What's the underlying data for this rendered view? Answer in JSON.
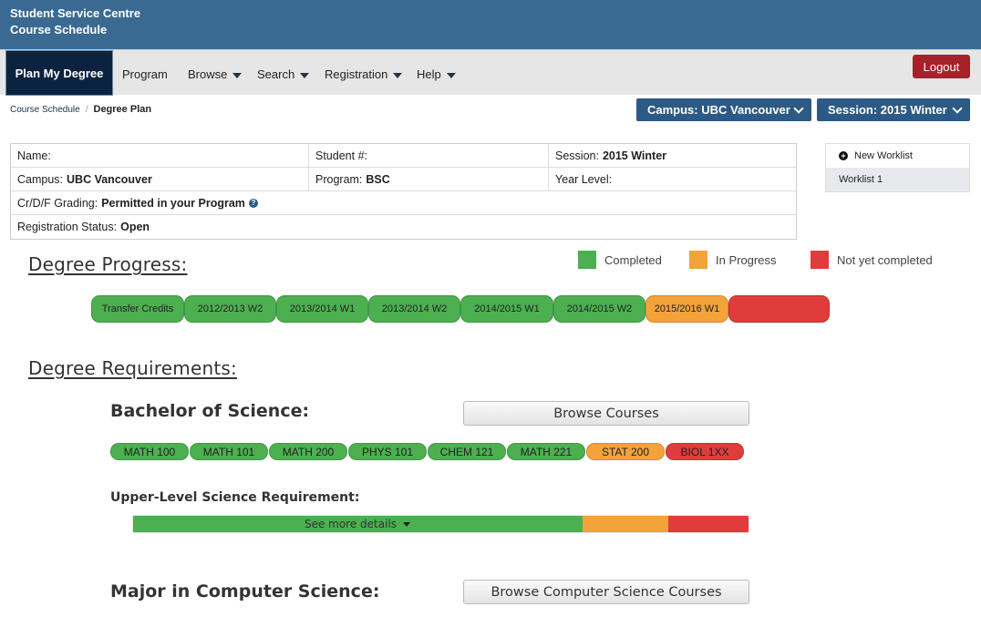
{
  "header": {
    "line1": "Student Service Centre",
    "line2": "Course Schedule"
  },
  "nav": {
    "active": "Plan My Degree",
    "items": [
      {
        "label": "Program",
        "dropdown": false
      },
      {
        "label": "Browse",
        "dropdown": true
      },
      {
        "label": "Search",
        "dropdown": true
      },
      {
        "label": "Registration",
        "dropdown": true
      },
      {
        "label": "Help",
        "dropdown": true
      }
    ],
    "logout": "Logout"
  },
  "breadcrumb": {
    "parent": "Course Schedule",
    "separator": "/",
    "current": "Degree Plan"
  },
  "selectors": {
    "campus": "Campus: UBC Vancouver",
    "session": "Session: 2015 Winter"
  },
  "student_info": {
    "name_label": "Name:",
    "student_no_label": "Student #:",
    "session_label": "Session:",
    "session_value": "2015 Winter",
    "campus_label": "Campus:",
    "campus_value": "UBC Vancouver",
    "program_label": "Program:",
    "program_value": "BSC",
    "year_label": "Year Level:",
    "grading_label": "Cr/D/F Grading:",
    "grading_value": "Permitted in your Program",
    "reg_label": "Registration Status:",
    "reg_value": "Open"
  },
  "worklist": {
    "new_label": "New Worklist",
    "items": [
      "Worklist 1"
    ]
  },
  "progress": {
    "title": "Degree Progress:",
    "legend": [
      {
        "label": "Completed",
        "color": "#4caf50"
      },
      {
        "label": "In Progress",
        "color": "#f4a23a"
      },
      {
        "label": "Not yet completed",
        "color": "#e03c3c"
      }
    ],
    "terms": [
      {
        "label": "Transfer Credits",
        "status": "completed"
      },
      {
        "label": "2012/2013 W2",
        "status": "completed"
      },
      {
        "label": "2013/2014 W1",
        "status": "completed"
      },
      {
        "label": "2013/2014 W2",
        "status": "completed"
      },
      {
        "label": "2014/2015 W1",
        "status": "completed"
      },
      {
        "label": "2014/2015 W2",
        "status": "completed"
      },
      {
        "label": "2015/2016 W1",
        "status": "in_progress"
      },
      {
        "label": "",
        "status": "not_completed"
      }
    ]
  },
  "requirements": {
    "title": "Degree Requirements:",
    "bsc": {
      "name": "Bachelor of Science:",
      "browse_label": "Browse Courses",
      "courses": [
        {
          "code": "MATH 100",
          "status": "completed"
        },
        {
          "code": "MATH 101",
          "status": "completed"
        },
        {
          "code": "MATH 200",
          "status": "completed"
        },
        {
          "code": "PHYS 101",
          "status": "completed"
        },
        {
          "code": "CHEM 121",
          "status": "completed"
        },
        {
          "code": "MATH 221",
          "status": "completed"
        },
        {
          "code": "STAT 200",
          "status": "in_progress"
        },
        {
          "code": "BIOL 1XX",
          "status": "not_completed"
        }
      ],
      "upper_level_label": "Upper-Level Science Requirement:",
      "upper_level_completed_fraction": 0.73,
      "upper_level_in_progress_fraction": 0.14,
      "upper_level_remaining_fraction": 0.13,
      "see_more": "See more details"
    },
    "major": {
      "name": "Major in Computer Science:",
      "browse_label": "Browse Computer Science Courses"
    }
  }
}
